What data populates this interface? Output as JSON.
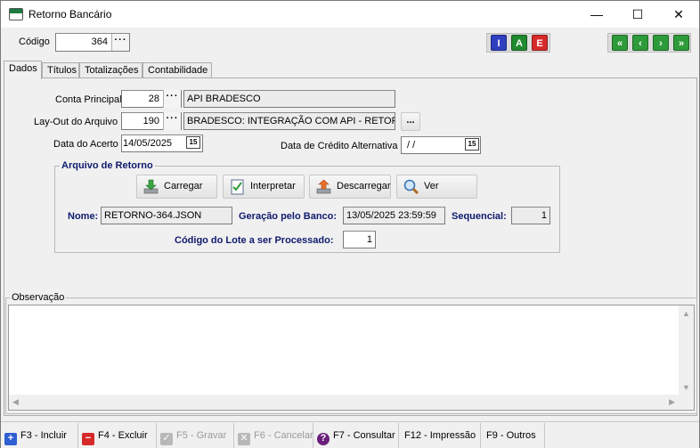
{
  "window": {
    "title": "Retorno Bancário",
    "minimize": "—",
    "maximize": "☐",
    "close": "✕"
  },
  "header": {
    "codigo_label": "Código",
    "codigo_value": "364",
    "lookup": "···",
    "buttons": [
      {
        "letter": "I",
        "color": "#2f3fbf"
      },
      {
        "letter": "A",
        "color": "#1f8a2e"
      },
      {
        "letter": "E",
        "color": "#d62a2a"
      }
    ],
    "nav": [
      {
        "glyph": "«",
        "name": "first"
      },
      {
        "glyph": "‹",
        "name": "previous"
      },
      {
        "glyph": "›",
        "name": "next"
      },
      {
        "glyph": "»",
        "name": "last"
      }
    ],
    "nav_color": "#2e9b3a"
  },
  "tabs": [
    "Dados",
    "Títulos",
    "Totalizações",
    "Contabilidade"
  ],
  "dados": {
    "conta_label": "Conta Principal",
    "conta_code": "28",
    "conta_desc": "API BRADESCO",
    "layout_label": "Lay-Out do Arquivo",
    "layout_code": "190",
    "layout_desc": "BRADESCO: INTEGRAÇÃO COM API - RETORNO",
    "layout_more": "...",
    "acerto_label": "Data do Acerto",
    "acerto_value": "14/05/2025",
    "credito_label": "Data de Crédito Alternativa",
    "credito_value": " /  /",
    "cal_glyph": "15"
  },
  "arquivo": {
    "title": "Arquivo de Retorno",
    "buttons": {
      "carregar": "Carregar",
      "interpretar": "Interpretar",
      "descarregar": "Descarregar",
      "ver": "Ver"
    },
    "nome_label": "Nome:",
    "nome_value": "RETORNO-364.JSON",
    "geracao_label": "Geração pelo Banco:",
    "geracao_value": "13/05/2025 23:59:59",
    "sequencial_label": "Sequencial:",
    "sequencial_value": "1",
    "lote_label": "Código do Lote a ser Processado:",
    "lote_value": "1"
  },
  "observacao": {
    "title": "Observação",
    "value": ""
  },
  "footer": [
    {
      "label": "F3 - Incluir",
      "icon": "+",
      "color": "#2f5fd0",
      "disabled": false
    },
    {
      "label": "F4 - Excluir",
      "icon": "−",
      "color": "#d62a2a",
      "disabled": false
    },
    {
      "label": "F5 - Gravar",
      "icon": "✓",
      "color": "#b8b8b8",
      "disabled": true
    },
    {
      "label": "F6 - Cancelar",
      "icon": "✕",
      "color": "#b8b8b8",
      "disabled": true
    },
    {
      "label": "F7 - Consultar",
      "icon": "?",
      "color": "#6a1f7a",
      "disabled": false
    },
    {
      "label": "F12 - Impressão",
      "icon": "",
      "color": "",
      "disabled": false
    },
    {
      "label": "F9 - Outros",
      "icon": "",
      "color": "",
      "disabled": false
    }
  ]
}
